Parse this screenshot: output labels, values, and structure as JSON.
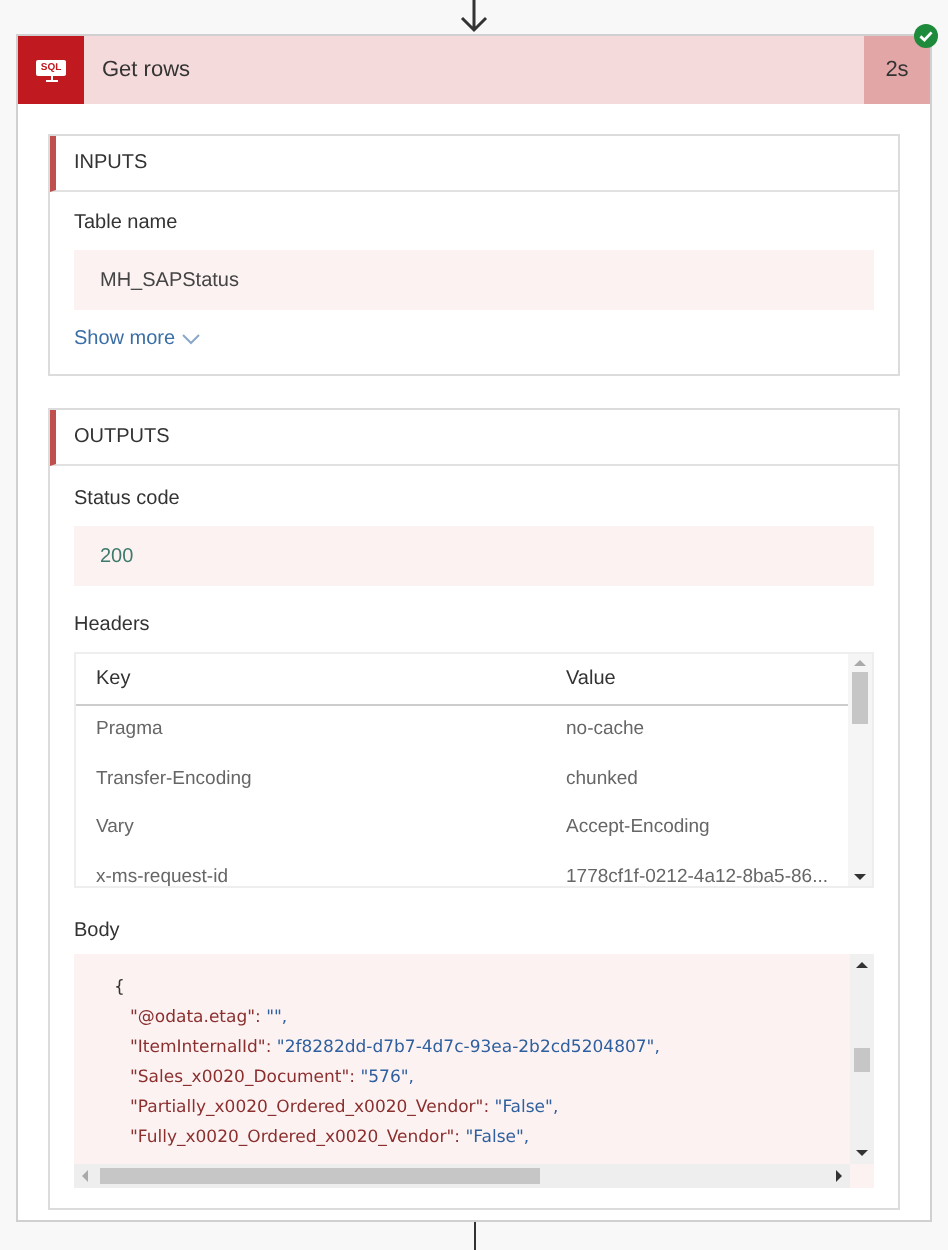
{
  "action": {
    "title": "Get rows",
    "icon_label": "SQL",
    "duration": "2s",
    "succeeded": true
  },
  "inputs": {
    "title": "INPUTS",
    "fields": [
      {
        "label": "Table name",
        "value": "MH_SAPStatus"
      }
    ],
    "show_more": "Show more"
  },
  "outputs": {
    "title": "OUTPUTS",
    "status_label": "Status code",
    "status_value": "200",
    "headers_label": "Headers",
    "headers": {
      "columns": [
        "Key",
        "Value"
      ],
      "rows": [
        {
          "key": "Pragma",
          "value": "no-cache"
        },
        {
          "key": "Transfer-Encoding",
          "value": "chunked"
        },
        {
          "key": "Vary",
          "value": "Accept-Encoding"
        },
        {
          "key": "x-ms-request-id",
          "value": "1778cf1f-0212-4a12-8ba5-86..."
        }
      ]
    },
    "body_label": "Body",
    "body_lines": [
      {
        "kind": "brace",
        "text": "{"
      },
      {
        "kind": "pair",
        "key": "\"@odata.etag\":",
        "value": "\"\","
      },
      {
        "kind": "pair",
        "key": "\"ItemInternalId\":",
        "value": "\"2f8282dd-d7b7-4d7c-93ea-2b2cd5204807\","
      },
      {
        "kind": "pair",
        "key": "\"Sales_x0020_Document\":",
        "value": "\"576\","
      },
      {
        "kind": "pair",
        "key": "\"Partially_x0020_Ordered_x0020_Vendor\":",
        "value": "\"False\","
      },
      {
        "kind": "pair",
        "key": "\"Fully_x0020_Ordered_x0020_Vendor\":",
        "value": "\"False\","
      }
    ]
  }
}
